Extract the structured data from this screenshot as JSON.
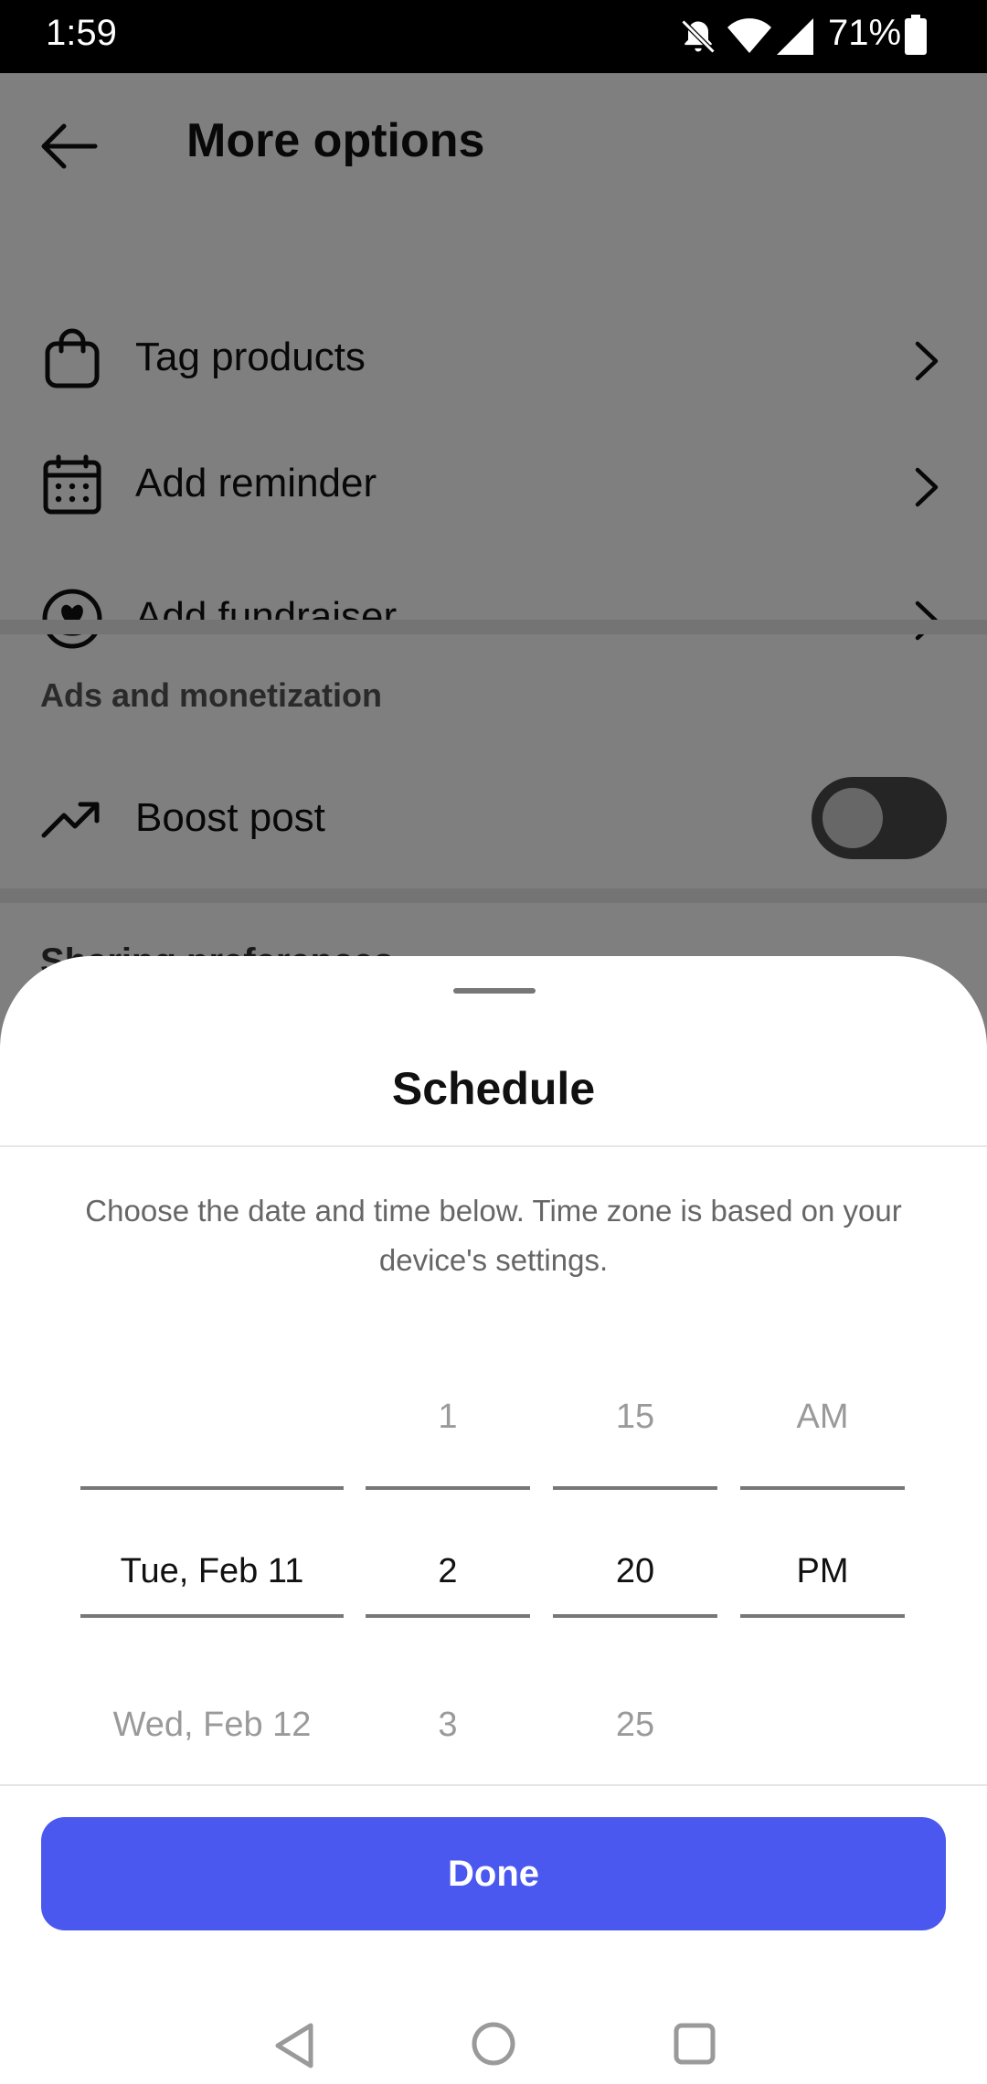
{
  "status_bar": {
    "time": "1:59",
    "battery_percent": "71%",
    "icons": [
      "bell-off-icon",
      "wifi-icon",
      "cellular-signal-icon",
      "battery-icon"
    ]
  },
  "header": {
    "back_icon": "arrow-left-icon",
    "title": "More options"
  },
  "options": [
    {
      "label": "Tag products",
      "icon": "shopping-bag-icon"
    },
    {
      "label": "Add reminder",
      "icon": "calendar-icon"
    },
    {
      "label": "Add fundraiser",
      "icon": "heart-badge-icon"
    }
  ],
  "ads_section": {
    "header": "Ads and monetization",
    "boost_label": "Boost post",
    "boost_icon": "trending-up-icon",
    "boost_enabled": false
  },
  "clipped_section_header": "Sharing preferences",
  "schedule_sheet": {
    "title": "Schedule",
    "description": "Choose the date and time below. Time zone is based on your device's settings.",
    "date_column": {
      "above": "",
      "selected": "Tue, Feb 11",
      "below": "Wed, Feb 12"
    },
    "hour_column": {
      "above": "1",
      "selected": "2",
      "below": "3"
    },
    "minute_column": {
      "above": "15",
      "selected": "20",
      "below": "25"
    },
    "ampm_column": {
      "above": "AM",
      "selected": "PM",
      "below": ""
    },
    "done_label": "Done"
  },
  "colors": {
    "accent": "#4a58ef",
    "scrim": "rgba(0,0,0,0.5)"
  },
  "nav_bar": [
    "nav-back-icon",
    "nav-home-icon",
    "nav-recents-icon"
  ]
}
